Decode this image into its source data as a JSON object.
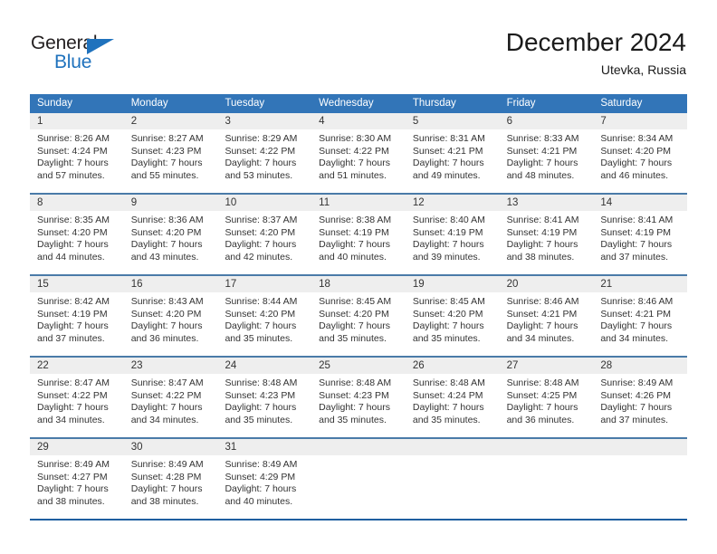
{
  "logo": {
    "primary_text": "General",
    "secondary_text": "Blue",
    "triangle_icon": "blue-triangle-icon",
    "primary_color": "#231f20",
    "secondary_color": "#1f72bd"
  },
  "header": {
    "title": "December 2024",
    "subtitle": "Utevka, Russia"
  },
  "theme": {
    "header_bar_color": "#3275b8",
    "day_band_color": "#eeeeee",
    "row_divider_color": "#4a7ba8",
    "bottom_divider_color": "#1f5fa0",
    "text_color": "#333333"
  },
  "calendar": {
    "weekday_headers": [
      "Sunday",
      "Monday",
      "Tuesday",
      "Wednesday",
      "Thursday",
      "Friday",
      "Saturday"
    ],
    "weeks": [
      [
        {
          "day": "1",
          "sunrise": "Sunrise: 8:26 AM",
          "sunset": "Sunset: 4:24 PM",
          "daylight_line1": "Daylight: 7 hours",
          "daylight_line2": "and 57 minutes."
        },
        {
          "day": "2",
          "sunrise": "Sunrise: 8:27 AM",
          "sunset": "Sunset: 4:23 PM",
          "daylight_line1": "Daylight: 7 hours",
          "daylight_line2": "and 55 minutes."
        },
        {
          "day": "3",
          "sunrise": "Sunrise: 8:29 AM",
          "sunset": "Sunset: 4:22 PM",
          "daylight_line1": "Daylight: 7 hours",
          "daylight_line2": "and 53 minutes."
        },
        {
          "day": "4",
          "sunrise": "Sunrise: 8:30 AM",
          "sunset": "Sunset: 4:22 PM",
          "daylight_line1": "Daylight: 7 hours",
          "daylight_line2": "and 51 minutes."
        },
        {
          "day": "5",
          "sunrise": "Sunrise: 8:31 AM",
          "sunset": "Sunset: 4:21 PM",
          "daylight_line1": "Daylight: 7 hours",
          "daylight_line2": "and 49 minutes."
        },
        {
          "day": "6",
          "sunrise": "Sunrise: 8:33 AM",
          "sunset": "Sunset: 4:21 PM",
          "daylight_line1": "Daylight: 7 hours",
          "daylight_line2": "and 48 minutes."
        },
        {
          "day": "7",
          "sunrise": "Sunrise: 8:34 AM",
          "sunset": "Sunset: 4:20 PM",
          "daylight_line1": "Daylight: 7 hours",
          "daylight_line2": "and 46 minutes."
        }
      ],
      [
        {
          "day": "8",
          "sunrise": "Sunrise: 8:35 AM",
          "sunset": "Sunset: 4:20 PM",
          "daylight_line1": "Daylight: 7 hours",
          "daylight_line2": "and 44 minutes."
        },
        {
          "day": "9",
          "sunrise": "Sunrise: 8:36 AM",
          "sunset": "Sunset: 4:20 PM",
          "daylight_line1": "Daylight: 7 hours",
          "daylight_line2": "and 43 minutes."
        },
        {
          "day": "10",
          "sunrise": "Sunrise: 8:37 AM",
          "sunset": "Sunset: 4:20 PM",
          "daylight_line1": "Daylight: 7 hours",
          "daylight_line2": "and 42 minutes."
        },
        {
          "day": "11",
          "sunrise": "Sunrise: 8:38 AM",
          "sunset": "Sunset: 4:19 PM",
          "daylight_line1": "Daylight: 7 hours",
          "daylight_line2": "and 40 minutes."
        },
        {
          "day": "12",
          "sunrise": "Sunrise: 8:40 AM",
          "sunset": "Sunset: 4:19 PM",
          "daylight_line1": "Daylight: 7 hours",
          "daylight_line2": "and 39 minutes."
        },
        {
          "day": "13",
          "sunrise": "Sunrise: 8:41 AM",
          "sunset": "Sunset: 4:19 PM",
          "daylight_line1": "Daylight: 7 hours",
          "daylight_line2": "and 38 minutes."
        },
        {
          "day": "14",
          "sunrise": "Sunrise: 8:41 AM",
          "sunset": "Sunset: 4:19 PM",
          "daylight_line1": "Daylight: 7 hours",
          "daylight_line2": "and 37 minutes."
        }
      ],
      [
        {
          "day": "15",
          "sunrise": "Sunrise: 8:42 AM",
          "sunset": "Sunset: 4:19 PM",
          "daylight_line1": "Daylight: 7 hours",
          "daylight_line2": "and 37 minutes."
        },
        {
          "day": "16",
          "sunrise": "Sunrise: 8:43 AM",
          "sunset": "Sunset: 4:20 PM",
          "daylight_line1": "Daylight: 7 hours",
          "daylight_line2": "and 36 minutes."
        },
        {
          "day": "17",
          "sunrise": "Sunrise: 8:44 AM",
          "sunset": "Sunset: 4:20 PM",
          "daylight_line1": "Daylight: 7 hours",
          "daylight_line2": "and 35 minutes."
        },
        {
          "day": "18",
          "sunrise": "Sunrise: 8:45 AM",
          "sunset": "Sunset: 4:20 PM",
          "daylight_line1": "Daylight: 7 hours",
          "daylight_line2": "and 35 minutes."
        },
        {
          "day": "19",
          "sunrise": "Sunrise: 8:45 AM",
          "sunset": "Sunset: 4:20 PM",
          "daylight_line1": "Daylight: 7 hours",
          "daylight_line2": "and 35 minutes."
        },
        {
          "day": "20",
          "sunrise": "Sunrise: 8:46 AM",
          "sunset": "Sunset: 4:21 PM",
          "daylight_line1": "Daylight: 7 hours",
          "daylight_line2": "and 34 minutes."
        },
        {
          "day": "21",
          "sunrise": "Sunrise: 8:46 AM",
          "sunset": "Sunset: 4:21 PM",
          "daylight_line1": "Daylight: 7 hours",
          "daylight_line2": "and 34 minutes."
        }
      ],
      [
        {
          "day": "22",
          "sunrise": "Sunrise: 8:47 AM",
          "sunset": "Sunset: 4:22 PM",
          "daylight_line1": "Daylight: 7 hours",
          "daylight_line2": "and 34 minutes."
        },
        {
          "day": "23",
          "sunrise": "Sunrise: 8:47 AM",
          "sunset": "Sunset: 4:22 PM",
          "daylight_line1": "Daylight: 7 hours",
          "daylight_line2": "and 34 minutes."
        },
        {
          "day": "24",
          "sunrise": "Sunrise: 8:48 AM",
          "sunset": "Sunset: 4:23 PM",
          "daylight_line1": "Daylight: 7 hours",
          "daylight_line2": "and 35 minutes."
        },
        {
          "day": "25",
          "sunrise": "Sunrise: 8:48 AM",
          "sunset": "Sunset: 4:23 PM",
          "daylight_line1": "Daylight: 7 hours",
          "daylight_line2": "and 35 minutes."
        },
        {
          "day": "26",
          "sunrise": "Sunrise: 8:48 AM",
          "sunset": "Sunset: 4:24 PM",
          "daylight_line1": "Daylight: 7 hours",
          "daylight_line2": "and 35 minutes."
        },
        {
          "day": "27",
          "sunrise": "Sunrise: 8:48 AM",
          "sunset": "Sunset: 4:25 PM",
          "daylight_line1": "Daylight: 7 hours",
          "daylight_line2": "and 36 minutes."
        },
        {
          "day": "28",
          "sunrise": "Sunrise: 8:49 AM",
          "sunset": "Sunset: 4:26 PM",
          "daylight_line1": "Daylight: 7 hours",
          "daylight_line2": "and 37 minutes."
        }
      ],
      [
        {
          "day": "29",
          "sunrise": "Sunrise: 8:49 AM",
          "sunset": "Sunset: 4:27 PM",
          "daylight_line1": "Daylight: 7 hours",
          "daylight_line2": "and 38 minutes."
        },
        {
          "day": "30",
          "sunrise": "Sunrise: 8:49 AM",
          "sunset": "Sunset: 4:28 PM",
          "daylight_line1": "Daylight: 7 hours",
          "daylight_line2": "and 38 minutes."
        },
        {
          "day": "31",
          "sunrise": "Sunrise: 8:49 AM",
          "sunset": "Sunset: 4:29 PM",
          "daylight_line1": "Daylight: 7 hours",
          "daylight_line2": "and 40 minutes."
        },
        {
          "day": "",
          "sunrise": "",
          "sunset": "",
          "daylight_line1": "",
          "daylight_line2": ""
        },
        {
          "day": "",
          "sunrise": "",
          "sunset": "",
          "daylight_line1": "",
          "daylight_line2": ""
        },
        {
          "day": "",
          "sunrise": "",
          "sunset": "",
          "daylight_line1": "",
          "daylight_line2": ""
        },
        {
          "day": "",
          "sunrise": "",
          "sunset": "",
          "daylight_line1": "",
          "daylight_line2": ""
        }
      ]
    ]
  }
}
